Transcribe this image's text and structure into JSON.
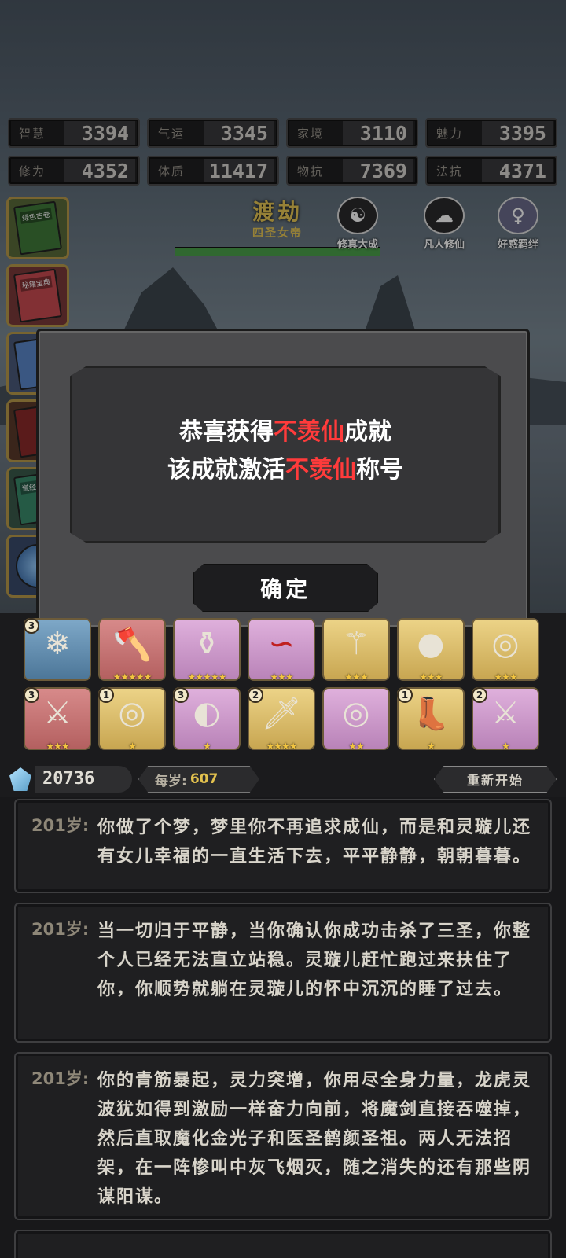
{
  "stats": [
    {
      "label": "智慧",
      "value": "3394"
    },
    {
      "label": "气运",
      "value": "3345"
    },
    {
      "label": "家境",
      "value": "3110"
    },
    {
      "label": "魅力",
      "value": "3395"
    },
    {
      "label": "修为",
      "value": "4352"
    },
    {
      "label": "体质",
      "value": "11417"
    },
    {
      "label": "物抗",
      "value": "7369"
    },
    {
      "label": "法抗",
      "value": "4371"
    }
  ],
  "sidebar": {
    "books": [
      "绿色古卷",
      "秘籍宝典",
      "",
      "",
      "道经大典",
      ""
    ]
  },
  "realm": {
    "title": "渡劫",
    "subtitle": "四圣女帝",
    "progress": 1.0
  },
  "badges": [
    {
      "label": "修真大成",
      "icon": "meditation-icon"
    },
    {
      "label": "凡人修仙",
      "icon": "cloud-icon"
    },
    {
      "label": "好感羁绊",
      "icon": "portrait-icon"
    }
  ],
  "dialog": {
    "line1_pre": "恭喜获得",
    "line1_hl": "不羡仙",
    "line1_post": "成就",
    "line2_pre": "该成就激活",
    "line2_hl": "不羡仙",
    "line2_post": "称号",
    "confirm": "确定",
    "highlight_color": "#ff3b3b"
  },
  "items": [
    {
      "count": "3",
      "stars": "",
      "icon": "crystal-icon"
    },
    {
      "count": "",
      "stars": "★★★★★",
      "icon": "axe-icon"
    },
    {
      "count": "",
      "stars": "★★★★★",
      "icon": "bottle-icon"
    },
    {
      "count": "",
      "stars": "★★★",
      "icon": "ribbon-icon"
    },
    {
      "count": "",
      "stars": "★★★",
      "icon": "staff-icon"
    },
    {
      "count": "",
      "stars": "★★★",
      "icon": "egg-icon"
    },
    {
      "count": "",
      "stars": "★★★",
      "icon": "ring-icon"
    },
    {
      "count": "3",
      "stars": "★★★",
      "icon": "sword-icon"
    },
    {
      "count": "1",
      "stars": "★",
      "icon": "ring-icon"
    },
    {
      "count": "3",
      "stars": "★",
      "icon": "fan-icon"
    },
    {
      "count": "2",
      "stars": "★★★★",
      "icon": "blade-icon"
    },
    {
      "count": "",
      "stars": "★★",
      "icon": "ring-icon"
    },
    {
      "count": "1",
      "stars": "★",
      "icon": "boots-icon"
    },
    {
      "count": "2",
      "stars": "★",
      "icon": "sword-icon"
    }
  ],
  "currency": {
    "amount": "20736",
    "per_year_label": "每岁:",
    "per_year_value": "607",
    "restart": "重新开始"
  },
  "log": [
    {
      "age": "201岁:",
      "text": "你做了个梦，梦里你不再追求成仙，而是和灵璇儿还有女儿幸福的一直生活下去，平平静静，朝朝暮暮。"
    },
    {
      "age": "201岁:",
      "text": "当一切归于平静，当你确认你成功击杀了三圣，你整个人已经无法直立站稳。灵璇儿赶忙跑过来扶住了你，你顺势就躺在灵璇儿的怀中沉沉的睡了过去。"
    },
    {
      "age": "201岁:",
      "text": "你的青筋暴起，灵力突增，你用尽全身力量，龙虎灵波犹如得到激励一样奋力向前，将魔剑直接吞噬掉，然后直取魔化金光子和医圣鹤颜圣祖。两人无法招架，在一阵惨叫中灰飞烟灭，随之消失的还有那些阴谋阳谋。"
    }
  ]
}
